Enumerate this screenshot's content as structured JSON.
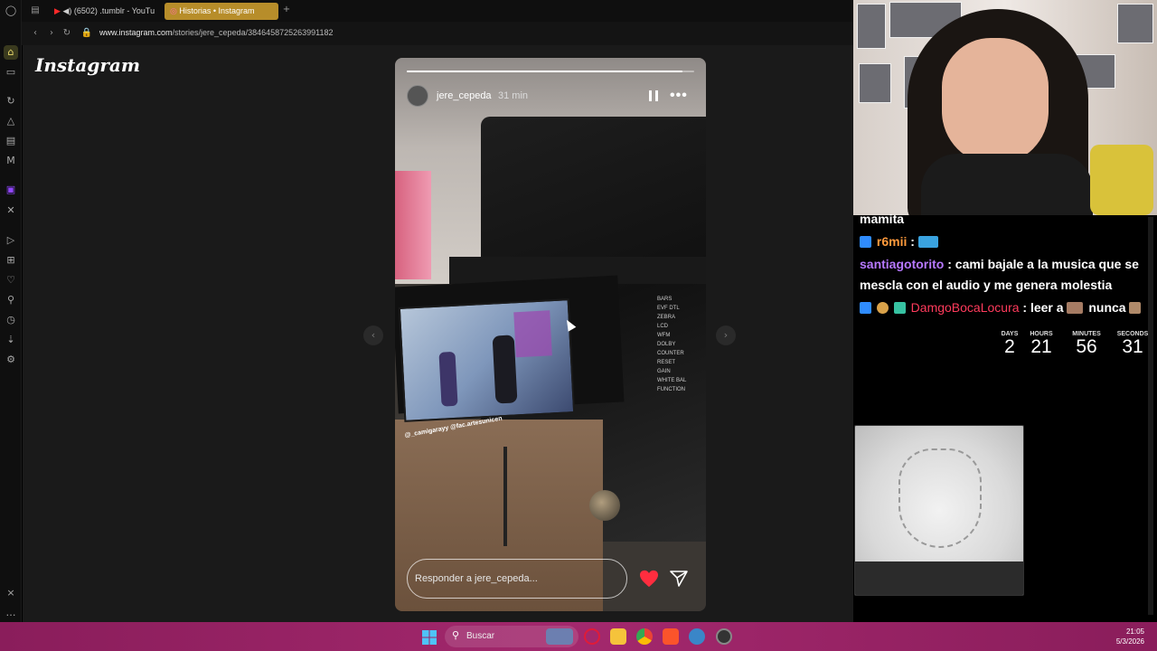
{
  "browser": {
    "tabs": [
      {
        "label": "(6502) .tumblr - YouTu",
        "active": false
      },
      {
        "label": "Historias • Instagram",
        "active": true
      }
    ],
    "url_host": "www.instagram.com",
    "url_path": "/stories/jere_cepeda/3846458725263991182",
    "new_tab_icon": "plus-icon"
  },
  "instagram": {
    "logo": "Instagram",
    "story": {
      "username": "jere_cepeda",
      "time_ago": "31 min",
      "progress": 0.96,
      "credit_tags": "@_camigarayy @fac.artesunicen",
      "panel_labels": [
        "BARS",
        "EVF DTL",
        "ZEBRA",
        "LCD",
        "WFM",
        "DOLBY",
        "COUNTER",
        "RESET",
        "GAIN",
        "WHITE BAL",
        "FUNCTION"
      ],
      "reply_placeholder": "Responder a jere_cepeda..."
    }
  },
  "chat": {
    "messages": [
      {
        "user": "",
        "text": "mamita",
        "color": "#ffffff"
      },
      {
        "user": "r6mii",
        "text": " :",
        "color": "#ff9a3c"
      },
      {
        "user": "santiagotorito",
        "text": " : cami bajale a la musica que se",
        "color": "#b779ff"
      },
      {
        "user": "",
        "text": "mescla con el audio y me genera molestia",
        "color": "#ffffff"
      },
      {
        "user": "DamgoBocaLocura",
        "text": " : leer a",
        "color": "#ff3b5c"
      }
    ],
    "msg5_tail": "nunca",
    "countdown": {
      "days_label": "DAYS",
      "days": "2",
      "hours_label": "HOURS",
      "hours": "21",
      "minutes_label": "MINUTES",
      "minutes": "56",
      "seconds_label": "SECONDS",
      "seconds": "31"
    }
  },
  "taskbar": {
    "search_label": "Buscar",
    "time": "21:05",
    "date": "5/3/2026"
  }
}
